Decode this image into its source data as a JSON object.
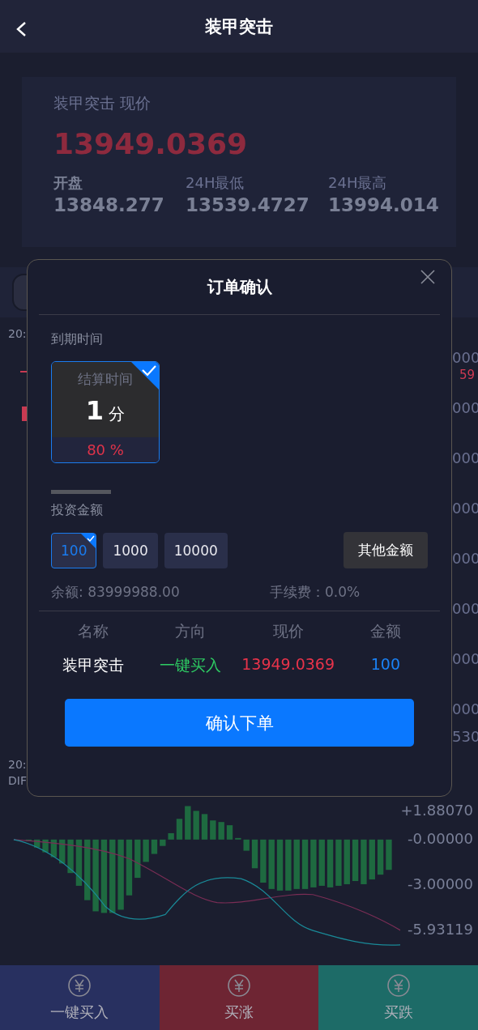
{
  "header": {
    "title": "装甲突击"
  },
  "quote": {
    "caption": "装甲突击 现价",
    "price": "13949.0369",
    "stats": [
      {
        "label": "开盘",
        "value": "13848.277",
        "emphasized": true
      },
      {
        "label": "24H最低",
        "value": "13539.4727",
        "emphasized": false
      },
      {
        "label": "24H最高",
        "value": "13994.014",
        "emphasized": false
      }
    ]
  },
  "price_chart": {
    "top_time": "20:",
    "axis_labels": [
      "000",
      "000",
      "000",
      "000",
      "000",
      "000",
      "000",
      "000",
      "530"
    ],
    "price_tag": "59",
    "axis_time": "20:"
  },
  "macd": {
    "indicator": "DIF",
    "axis_labels": [
      "+1.88070",
      "-0.00000",
      "-3.00000",
      "-5.93119"
    ]
  },
  "actions": [
    {
      "label": "一键买入",
      "color": "#283060"
    },
    {
      "label": "买涨",
      "color": "#6e2533"
    },
    {
      "label": "买跌",
      "color": "#1d6b67"
    }
  ],
  "dialog": {
    "title": "订单确认",
    "expiry_label": "到期时间",
    "expiry_options": [
      {
        "caption": "结算时间",
        "number": "1",
        "unit": "分",
        "rate": "80 %",
        "selected": true
      }
    ],
    "amount_label": "投资金额",
    "amounts": [
      {
        "label": "100",
        "selected": true
      },
      {
        "label": "1000",
        "selected": false
      },
      {
        "label": "10000",
        "selected": false
      }
    ],
    "other_amount": "其他金额",
    "balance": "余额: 83999988.00",
    "fee": "手续费：0.0%",
    "columns": [
      "名称",
      "方向",
      "现价",
      "金额"
    ],
    "values": [
      {
        "text": "装甲突击",
        "kind": "name"
      },
      {
        "text": "一键买入",
        "kind": "direction"
      },
      {
        "text": "13949.0369",
        "kind": "price"
      },
      {
        "text": "100",
        "kind": "amount"
      }
    ],
    "confirm": "确认下单"
  }
}
